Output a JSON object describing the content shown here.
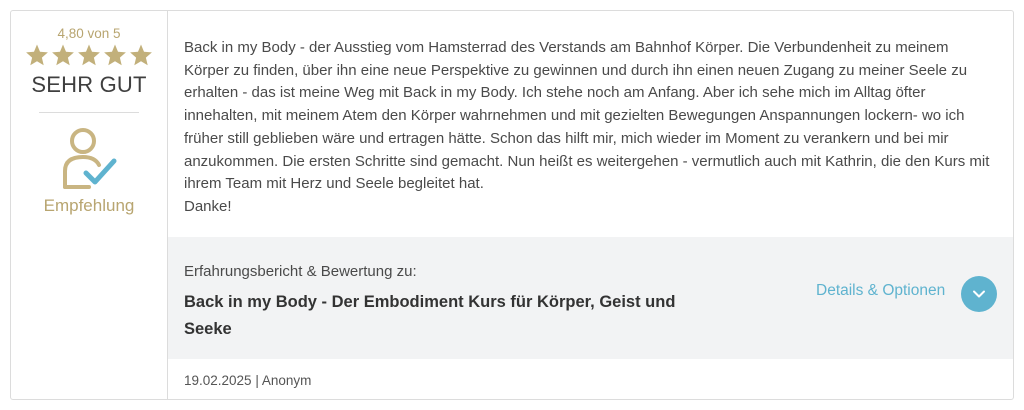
{
  "rating": {
    "score_text": "4,80 von 5",
    "stars": 5,
    "verdict": "SEHR GUT",
    "star_color": "#c2b07b"
  },
  "recommendation": {
    "icon": "user-check-icon",
    "label": "Empfehlung"
  },
  "review": {
    "text": "Back in my Body - der Ausstieg vom Hamsterrad des Verstands am Bahnhof Körper. Die Verbundenheit zu meinem Körper zu finden, über ihn eine neue Perspektive zu gewinnen und durch ihn einen neuen Zugang zu meiner Seele zu erhalten - das ist meine Weg mit Back in my Body. Ich stehe noch am Anfang. Aber ich sehe mich im Alltag öfter innehalten, mit meinem Atem den Körper wahrnehmen und mit gezielten Bewegungen Anspannungen lockern- wo ich früher still geblieben wäre und ertragen hätte. Schon das hilft mir, mich wieder im Moment zu verankern und bei mir anzukommen. Die ersten Schritte sind gemacht. Nun heißt es weitergehen - vermutlich auch mit Kathrin, die den Kurs mit ihrem Team mit Herz und Seele begleitet hat.\nDanke!"
  },
  "reference": {
    "label": "Erfahrungsbericht & Bewertung zu:",
    "title": "Back in my Body - Der Embodiment Kurs für Körper, Geist und Seeke",
    "details_link": "Details & Optionen",
    "accent_color": "#5fb3cf"
  },
  "meta": {
    "date_author": "19.02.2025 | Anonym"
  }
}
